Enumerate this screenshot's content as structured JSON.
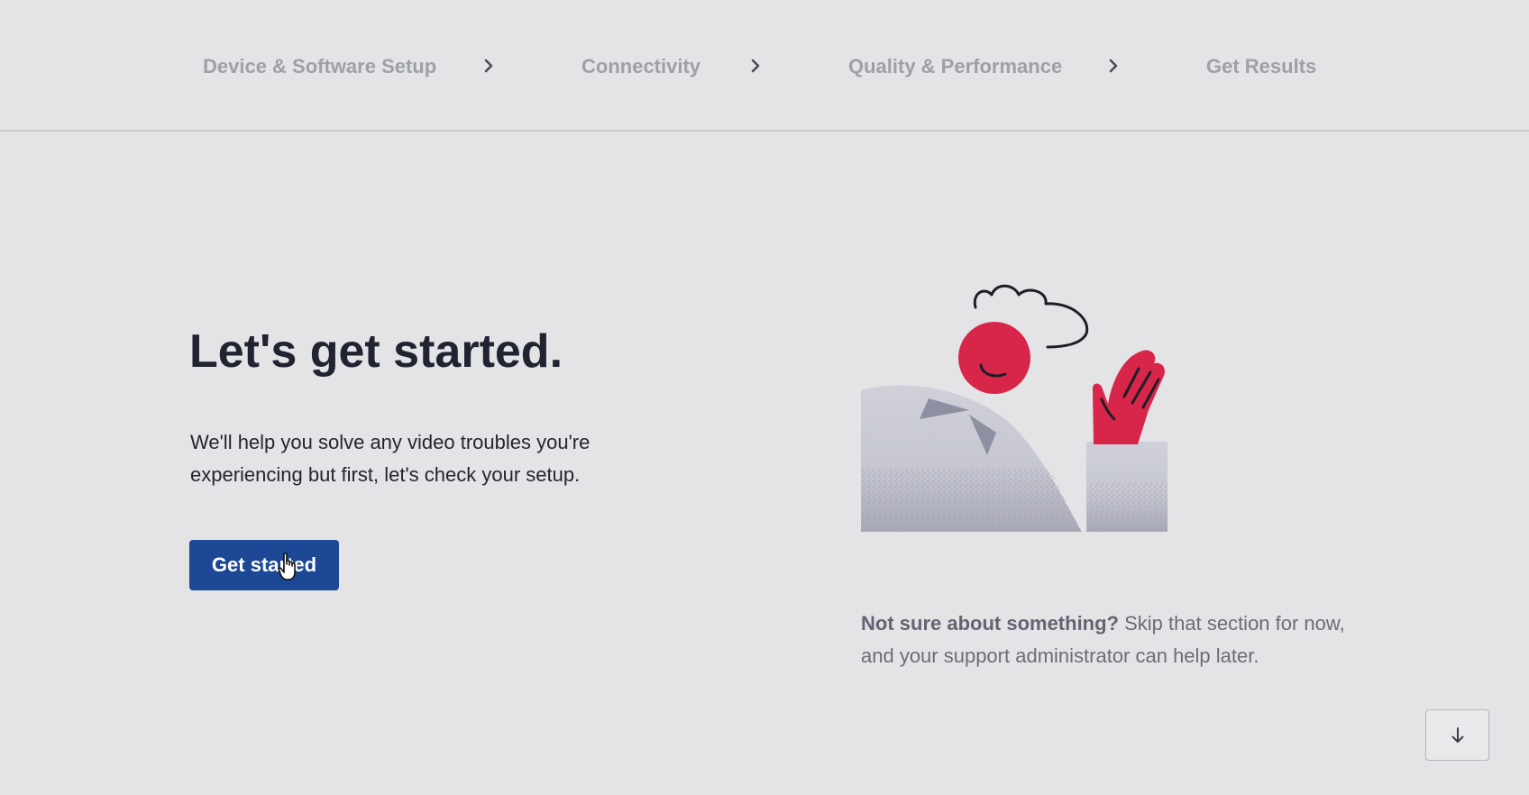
{
  "stepper": {
    "steps": [
      {
        "label": "Device & Software Setup"
      },
      {
        "label": "Connectivity"
      },
      {
        "label": "Quality & Performance"
      },
      {
        "label": "Get Results"
      }
    ],
    "separator_icon": "chevron-right-icon"
  },
  "hero": {
    "title": "Let's get started.",
    "description": "We'll help you solve any video troubles you're experiencing but first, let's check your setup.",
    "cta_label": "Get started"
  },
  "note": {
    "bold": "Not sure about something?",
    "text": " Skip that section for now, and your support administrator can help later."
  },
  "scroll_button": {
    "icon": "arrow-down-icon"
  },
  "colors": {
    "background": "#e4e4e7",
    "primary": "#1c4896",
    "accent": "#d8254a",
    "step_text": "#9ea0a8"
  }
}
